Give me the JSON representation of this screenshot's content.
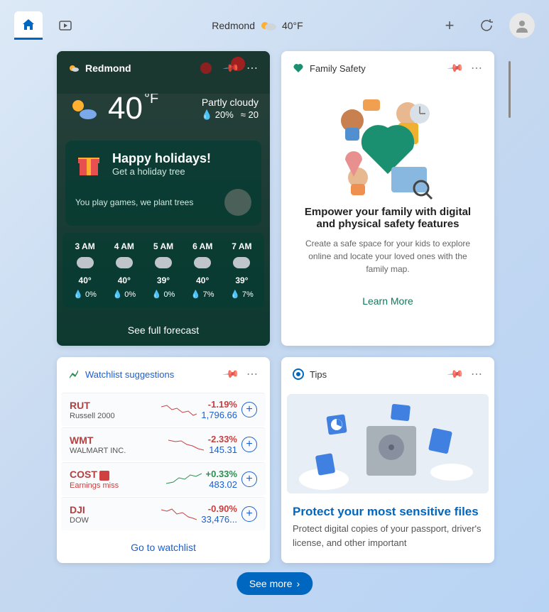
{
  "topbar": {
    "location": "Redmond",
    "temp": "40°F"
  },
  "weather": {
    "title": "Redmond",
    "temp": "40",
    "unit": "°F",
    "condition": "Partly cloudy",
    "precip": "20%",
    "wind": "20",
    "holiday": {
      "title": "Happy holidays!",
      "subtitle": "Get a holiday tree",
      "text": "You play games, we plant trees"
    },
    "hourly": [
      {
        "time": "3 AM",
        "temp": "40°",
        "prec": "0%"
      },
      {
        "time": "4 AM",
        "temp": "40°",
        "prec": "0%"
      },
      {
        "time": "5 AM",
        "temp": "39°",
        "prec": "0%"
      },
      {
        "time": "6 AM",
        "temp": "40°",
        "prec": "7%"
      },
      {
        "time": "7 AM",
        "temp": "39°",
        "prec": "7%"
      }
    ],
    "forecast_link": "See full forecast"
  },
  "family": {
    "title": "Family Safety",
    "heading": "Empower your family with digital and physical safety features",
    "description": "Create a safe space for your kids to explore online and locate your loved ones with the family map.",
    "link": "Learn More"
  },
  "watchlist": {
    "title": "Watchlist suggestions",
    "stocks": [
      {
        "sym": "RUT",
        "name": "Russell 2000",
        "change": "-1.19%",
        "price": "1,796.66",
        "dir": "neg"
      },
      {
        "sym": "WMT",
        "name": "WALMART INC.",
        "change": "-2.33%",
        "price": "145.31",
        "dir": "neg"
      },
      {
        "sym": "COST",
        "name": "Earnings miss",
        "change": "+0.33%",
        "price": "483.02",
        "dir": "pos",
        "badge": true
      },
      {
        "sym": "DJI",
        "name": "DOW",
        "change": "-0.90%",
        "price": "33,476...",
        "dir": "neg"
      }
    ],
    "link": "Go to watchlist"
  },
  "tips": {
    "title": "Tips",
    "heading": "Protect your most sensitive files",
    "description": "Protect digital copies of your passport, driver's license, and other important"
  },
  "see_more": "See more"
}
